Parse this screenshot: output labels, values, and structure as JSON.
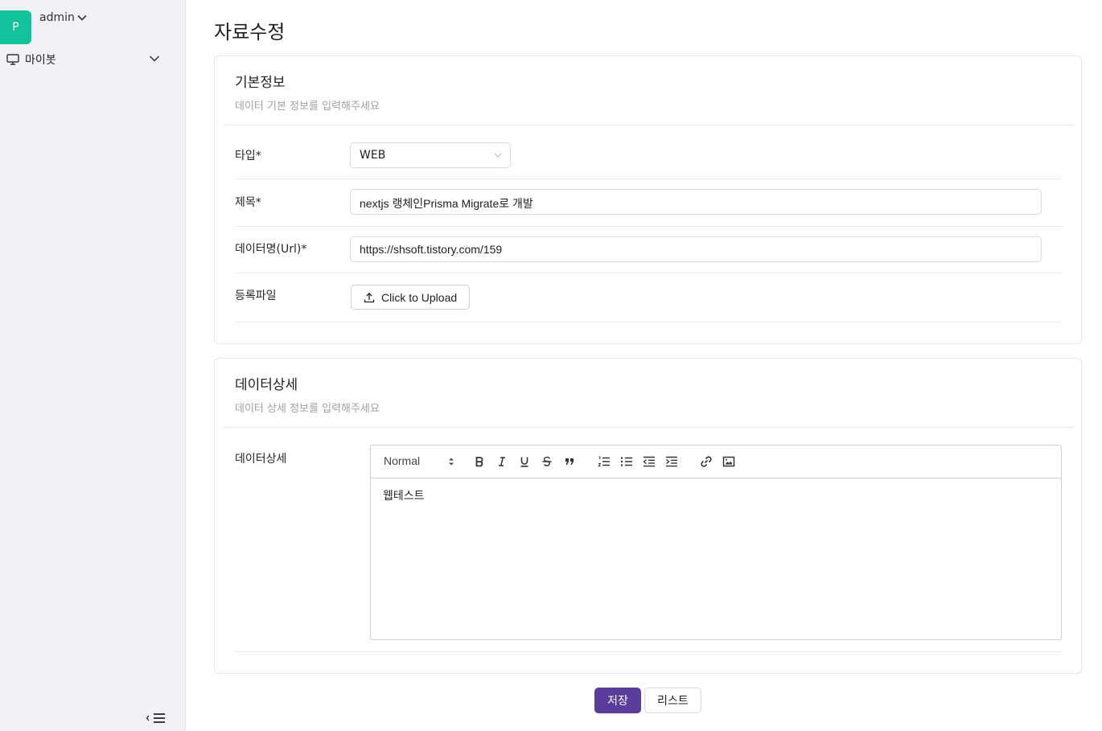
{
  "sidebar": {
    "avatar_initial": "P",
    "user_name": "admin",
    "menu": [
      {
        "label": "마이봇",
        "icon": "monitor-icon"
      }
    ],
    "collapse_icon": "menu-fold-icon"
  },
  "page": {
    "title": "자료수정"
  },
  "basic_card": {
    "title": "기본정보",
    "subtitle": "데이터 기본 정보를 입력해주세요",
    "fields": {
      "type": {
        "label": "타입*",
        "value": "WEB"
      },
      "title": {
        "label": "제목*",
        "value": "nextjs 랭체인Prisma Migrate로 개발"
      },
      "url": {
        "label": "데이터명(Url)*",
        "value": "https://shsoft.tistory.com/159"
      },
      "file": {
        "label": "등록파일",
        "button_label": "Click to Upload"
      }
    }
  },
  "detail_card": {
    "title": "데이터상세",
    "subtitle": "데이터 상세 정보를 입력해주세요",
    "field_label": "데이터상세",
    "editor": {
      "format_value": "Normal",
      "toolbar_icons": [
        "bold-icon",
        "italic-icon",
        "underline-icon",
        "strike-icon",
        "blockquote-icon",
        "ordered-list-icon",
        "bullet-list-icon",
        "outdent-icon",
        "indent-icon",
        "link-icon",
        "image-icon"
      ],
      "content": "웹테스트"
    }
  },
  "actions": {
    "save_label": "저장",
    "list_label": "리스트"
  },
  "colors": {
    "accent": "#5a3d9a",
    "avatar": "#13c29a",
    "sidebar_bg": "#f0f2f5"
  }
}
